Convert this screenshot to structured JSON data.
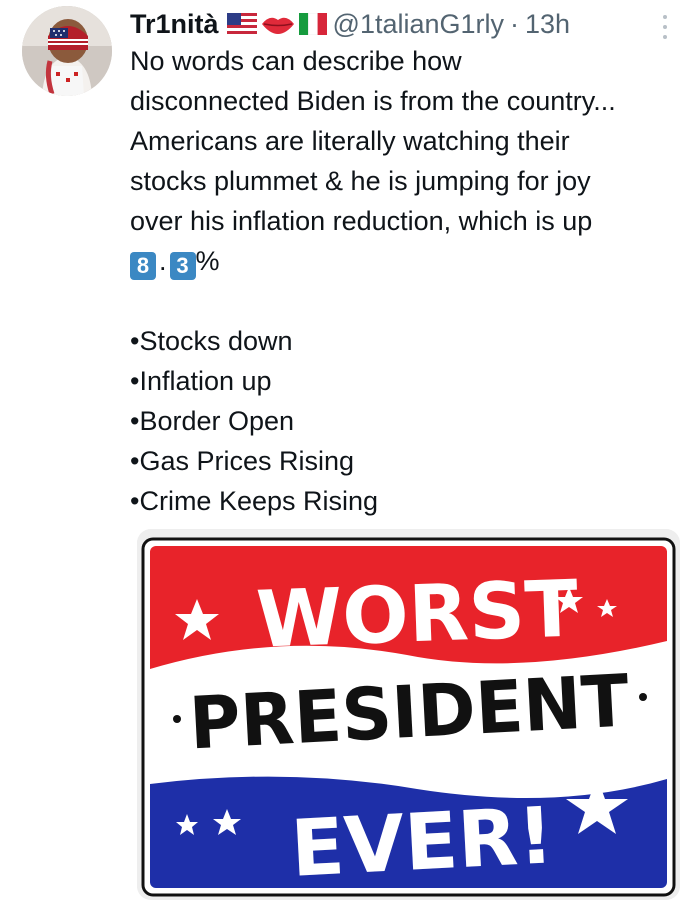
{
  "tweet": {
    "author_name": "Tr1nità",
    "author_flags": [
      "us-flag-icon",
      "lips-icon",
      "italy-flag-icon"
    ],
    "handle": "@1talianG1rly",
    "separator": "·",
    "time": "13h",
    "body_lines": [
      "No words can describe how",
      "disconnected Biden is from the country...",
      "Americans are literally watching their",
      "stocks plummet & he is jumping for joy",
      "over his inflation reduction, which is up"
    ],
    "percent": {
      "digit1": "8",
      "dot": ".",
      "digit2": "3",
      "sign": "%"
    },
    "bullets": [
      "•Stocks down",
      "•Inflation up",
      "•Border Open",
      "•Gas Prices Rising",
      "•Crime Keeps Rising"
    ]
  },
  "image": {
    "line1": "WORST",
    "line2": "PRESIDENT",
    "line3": "EVER!",
    "colors": {
      "red": "#e8232a",
      "blue": "#1e2fa8",
      "white": "#ffffff",
      "black": "#111111"
    }
  }
}
